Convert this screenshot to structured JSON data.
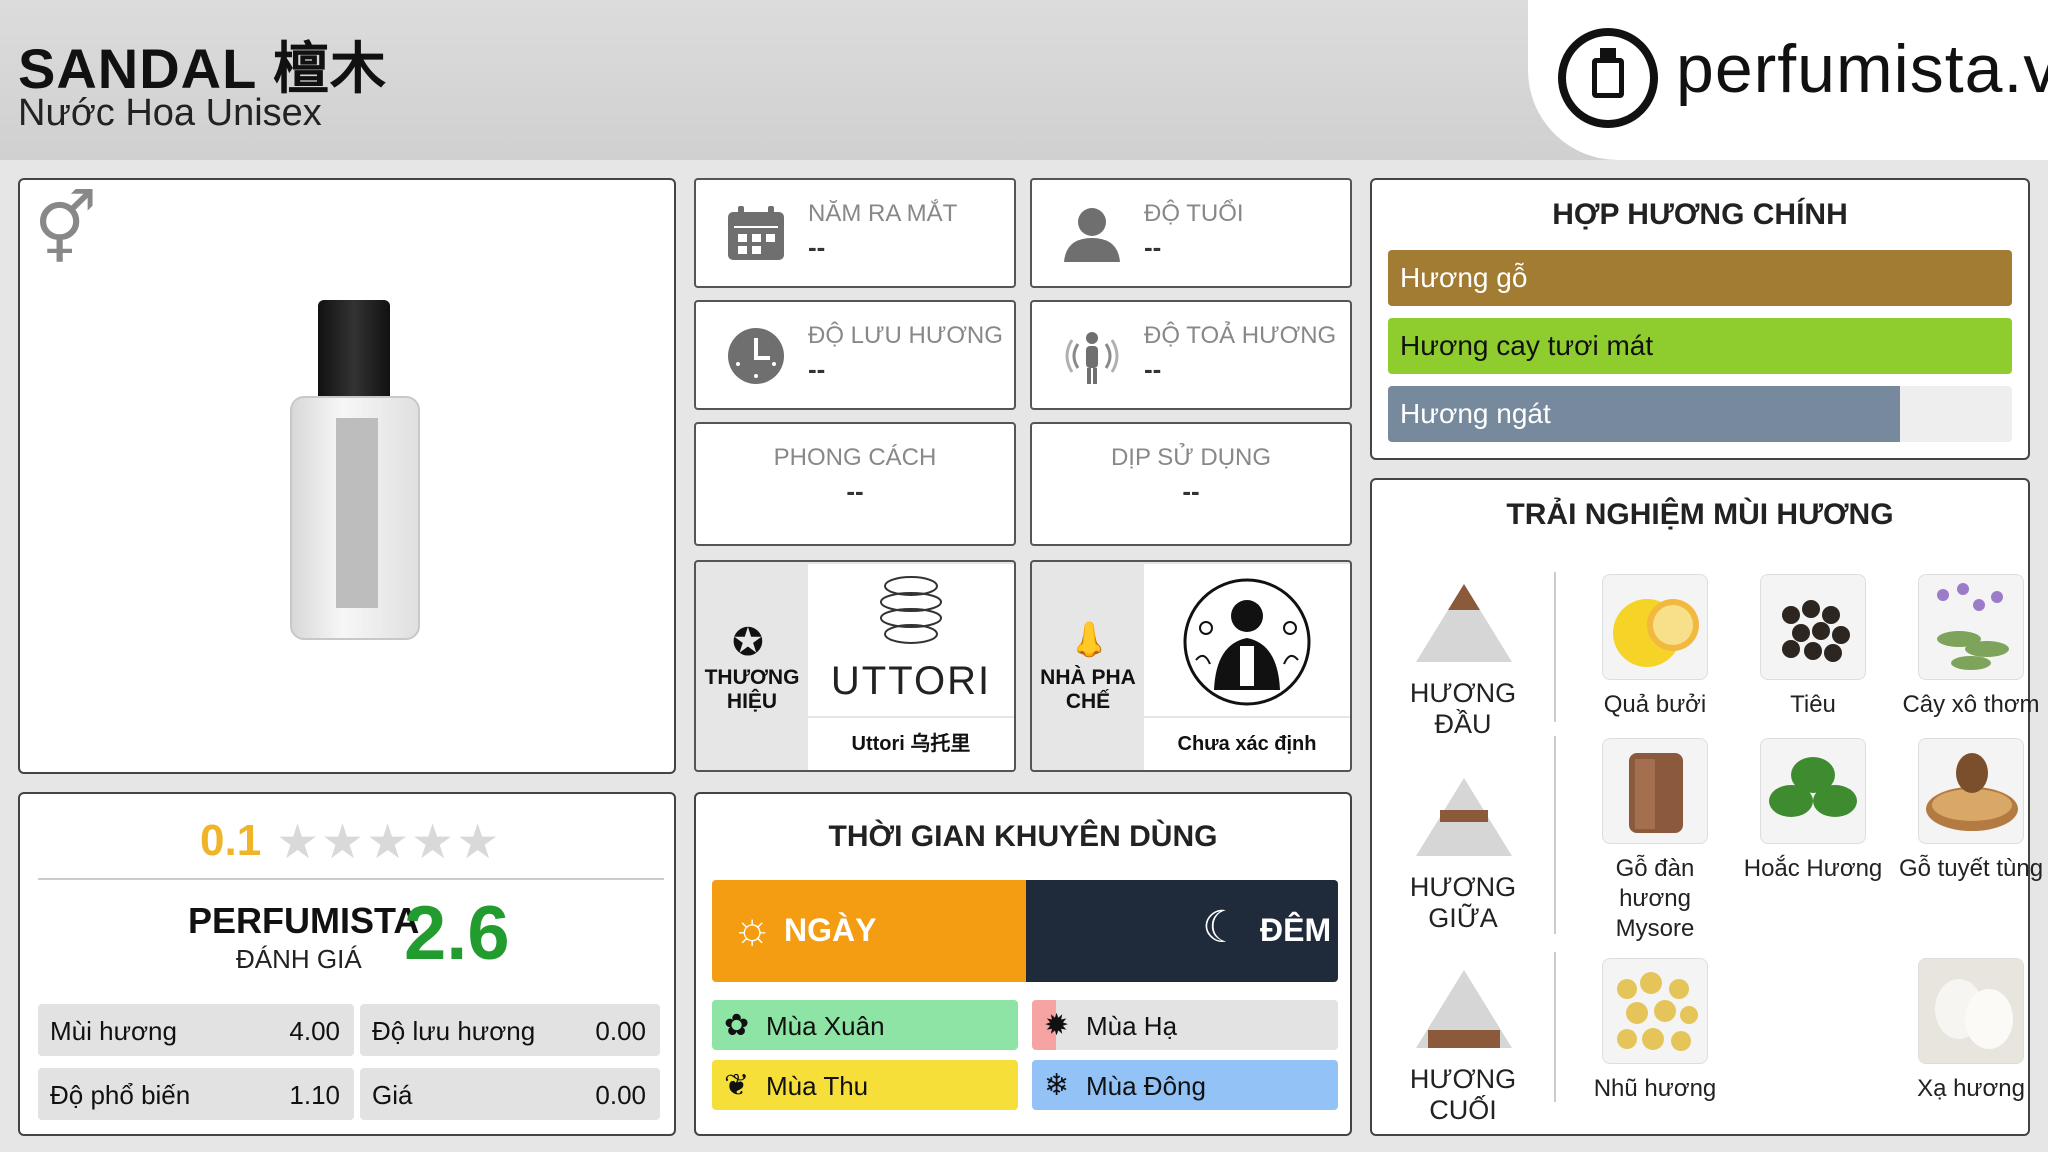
{
  "header": {
    "title": "SANDAL 檀木",
    "subtitle": "Nước Hoa Unisex",
    "logo_text": "perfumista.vn"
  },
  "rating": {
    "user_score": "0.1",
    "stars": "★★★★★",
    "perfumista_label": "PERFUMISTA",
    "perfumista_sub": "ĐÁNH GIÁ",
    "perfumista_score": "2.6",
    "metrics": [
      {
        "label": "Mùi hương",
        "value": "4.00"
      },
      {
        "label": "Độ lưu hương",
        "value": "0.00"
      },
      {
        "label": "Độ phổ biến",
        "value": "1.10"
      },
      {
        "label": "Giá",
        "value": "0.00"
      }
    ]
  },
  "info": {
    "release": {
      "label": "NĂM RA MẮT",
      "value": "--"
    },
    "age": {
      "label": "ĐỘ TUỔI",
      "value": "--"
    },
    "longevity": {
      "label": "ĐỘ LƯU HƯƠNG",
      "value": "--"
    },
    "sillage": {
      "label": "ĐỘ TOẢ HƯƠNG",
      "value": "--"
    },
    "style": {
      "label": "PHONG CÁCH",
      "value": "--"
    },
    "occasion": {
      "label": "DỊP SỬ DỤNG",
      "value": "--"
    },
    "brand": {
      "label": "THƯƠNG HIỆU",
      "logo_text": "UTTORI",
      "name": "Uttori 乌托里"
    },
    "perfumer": {
      "label": "NHÀ PHA CHẾ",
      "name": "Chưa xác định"
    }
  },
  "accords": {
    "title": "HỢP HƯƠNG CHÍNH",
    "items": [
      {
        "label": "Hương gỗ",
        "percent": 100,
        "color": "#a27c33"
      },
      {
        "label": "Hương cay tươi mát",
        "percent": 100,
        "color": "#8fcd2f"
      },
      {
        "label": "Hương ngát",
        "percent": 82,
        "color": "#77899c"
      }
    ]
  },
  "time": {
    "title": "THỜI GIAN KHUYÊN DÙNG",
    "day": "NGÀY",
    "night": "ĐÊM",
    "seasons": [
      {
        "label": "Mùa Xuân",
        "color": "#8de4a4"
      },
      {
        "label": "Mùa Hạ",
        "color": "#e3e3e3"
      },
      {
        "label": "Mùa Thu",
        "color": "#f7df3a"
      },
      {
        "label": "Mùa Đông",
        "color": "#93c2f7"
      }
    ]
  },
  "notes": {
    "title": "TRẢI NGHIỆM MÙI HƯƠNG",
    "top": {
      "label": "HƯƠNG ĐẦU",
      "items": [
        "Quả bưởi",
        "Tiêu",
        "Cây xô thơm"
      ]
    },
    "middle": {
      "label": "HƯƠNG GIỮA",
      "items": [
        "Gỗ đàn hương Mysore",
        "Hoắc Hương",
        "Gỗ tuyết tùng"
      ]
    },
    "base": {
      "label": "HƯƠNG CUỐI",
      "items": [
        "Nhũ hương",
        "Xạ hương"
      ]
    }
  }
}
